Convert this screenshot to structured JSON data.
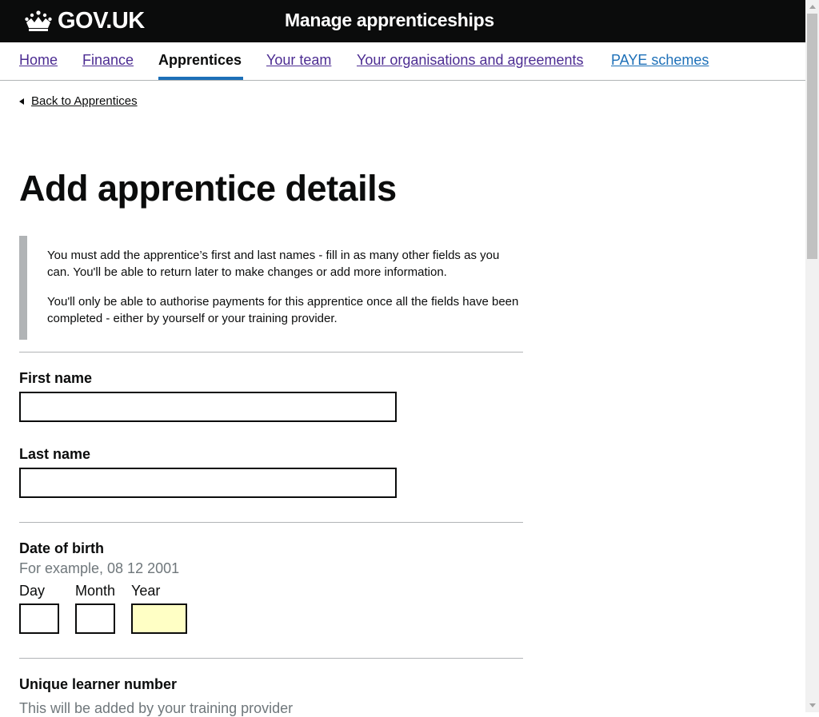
{
  "header": {
    "logo_text": "GOV.UK",
    "service_name": "Manage apprenticeships"
  },
  "nav": {
    "items": [
      {
        "label": "Home"
      },
      {
        "label": "Finance"
      },
      {
        "label": "Apprentices",
        "active": true
      },
      {
        "label": "Your team"
      },
      {
        "label": "Your organisations and agreements"
      },
      {
        "label": "PAYE schemes"
      }
    ]
  },
  "back_link": {
    "label": "Back to Apprentices"
  },
  "page": {
    "title": "Add apprentice details",
    "inset_p1": "You must add the apprentice’s first and last names - fill in as many other fields as you can. You'll be able to return later to make changes or add more information.",
    "inset_p2": "You'll only be able to authorise payments for this apprentice once all the fields have been completed - either by yourself or your training provider."
  },
  "form": {
    "first_name": {
      "label": "First name",
      "value": ""
    },
    "last_name": {
      "label": "Last name",
      "value": ""
    },
    "dob": {
      "label": "Date of birth",
      "hint": "For example, 08 12 2001",
      "day_label": "Day",
      "month_label": "Month",
      "year_label": "Year",
      "day": "",
      "month": "",
      "year": ""
    },
    "uln": {
      "label": "Unique learner number",
      "hint": "This will be added by your training provider"
    }
  },
  "colors": {
    "header_bg": "#0b0c0c",
    "link": "#1d70b8",
    "visited_link": "#4c2c92",
    "focus_fill": "#ffffc5"
  }
}
